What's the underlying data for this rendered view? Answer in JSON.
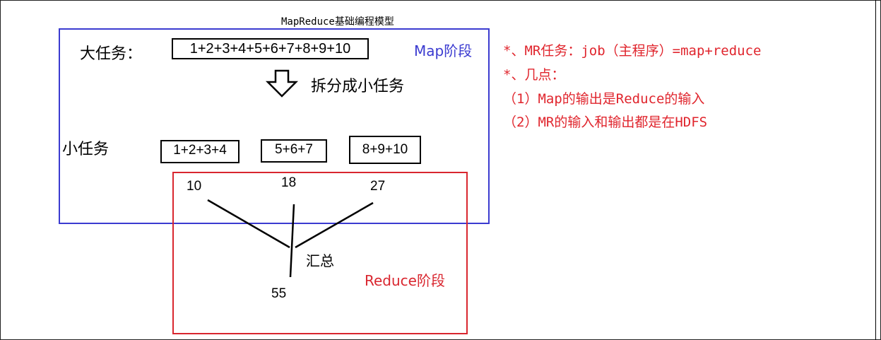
{
  "title": "MapReduce基础编程模型",
  "map_stage": {
    "task_label": "大任务：",
    "task_value": "1+2+3+4+5+6+7+8+9+10",
    "stage_label": "Map阶段",
    "split_label": "拆分成小任务",
    "subtasks_label": "小任务",
    "subtasks": [
      "1+2+3+4",
      "5+6+7",
      "8+9+10"
    ]
  },
  "reduce_stage": {
    "partial_results": [
      "10",
      "18",
      "27"
    ],
    "sum_label": "汇总",
    "result": "55",
    "stage_label": "Reduce阶段"
  },
  "notes": [
    "*、MR任务：job（主程序）=map+reduce",
    "*、几点：",
    "（1）Map的输出是Reduce的输入",
    "（2）MR的输入和输出都是在HDFS"
  ],
  "colors": {
    "map_border": "#3b3bd0",
    "reduce_border": "#d9262f",
    "note_text": "#e0252d"
  }
}
